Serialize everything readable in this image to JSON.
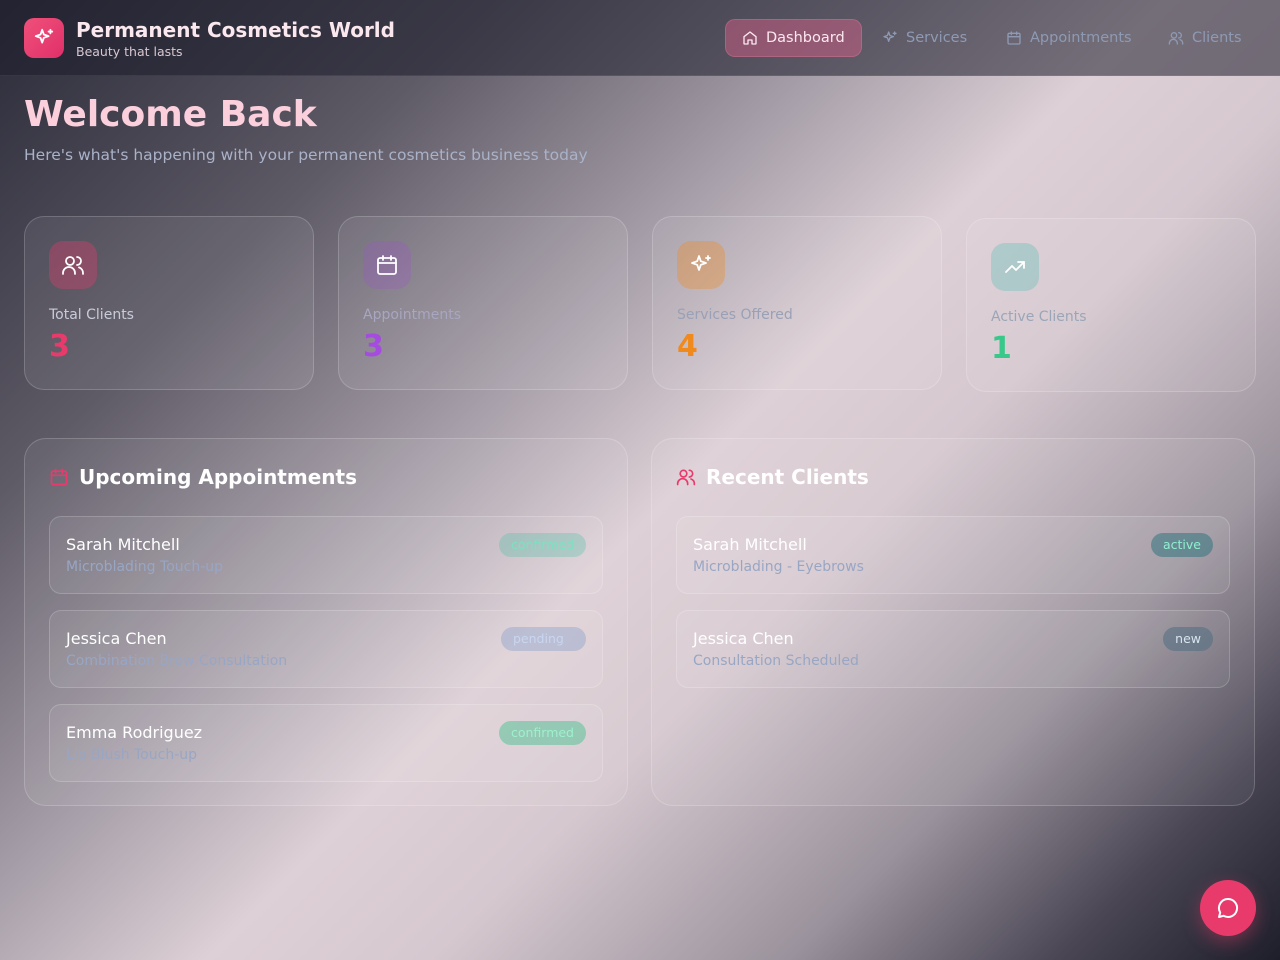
{
  "brand": {
    "title": "Permanent Cosmetics World",
    "tagline": "Beauty that lasts"
  },
  "nav": [
    {
      "label": "Dashboard",
      "icon": "home-icon",
      "active": true
    },
    {
      "label": "Services",
      "icon": "sparkles-icon",
      "active": false
    },
    {
      "label": "Appointments",
      "icon": "calendar-icon",
      "active": false
    },
    {
      "label": "Clients",
      "icon": "users-icon",
      "active": false
    }
  ],
  "welcome": {
    "title": "Welcome Back",
    "subtitle": "Here's what's happening with your permanent cosmetics business today"
  },
  "stats": [
    {
      "label": "Total Clients",
      "value": "3",
      "icon": "users-icon",
      "color": "#e83b6c"
    },
    {
      "label": "Appointments",
      "value": "3",
      "icon": "calendar-icon",
      "color": "#a64be0"
    },
    {
      "label": "Services Offered",
      "value": "4",
      "icon": "sparkles-icon",
      "color": "#f08a1c"
    },
    {
      "label": "Active Clients",
      "value": "1",
      "icon": "trending-up-icon",
      "color": "#38c98a"
    }
  ],
  "appointments": {
    "title": "Upcoming Appointments",
    "items": [
      {
        "name": "Sarah Mitchell",
        "service": "Microblading Touch-up",
        "status": "confirmed"
      },
      {
        "name": "Jessica Chen",
        "service": "Combination Brow Consultation",
        "status": "pending"
      },
      {
        "name": "Emma Rodriguez",
        "service": "Lip Blush Touch-up",
        "status": "confirmed"
      }
    ]
  },
  "clients": {
    "title": "Recent Clients",
    "items": [
      {
        "name": "Sarah Mitchell",
        "detail": "Microblading - Eyebrows",
        "status": "active"
      },
      {
        "name": "Jessica Chen",
        "detail": "Consultation Scheduled",
        "status": "new"
      }
    ]
  },
  "chat": {
    "icon": "chat-bubble-icon",
    "color": "#e83b6c"
  }
}
